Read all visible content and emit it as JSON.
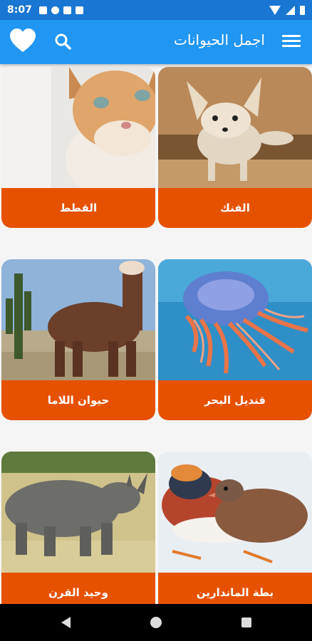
{
  "status_bar": {
    "time": "8:07"
  },
  "app_bar": {
    "title": "اجمل الحيوانات",
    "icons": [
      "heart-icon",
      "search-icon",
      "menu-icon"
    ],
    "color": "#2196f3"
  },
  "animals": [
    {
      "name": "الفنك",
      "image": "fennec-fox"
    },
    {
      "name": "القطط",
      "image": "cat"
    },
    {
      "name": "قنديل البحر",
      "image": "jellyfish"
    },
    {
      "name": "حيوان اللاما",
      "image": "llama"
    },
    {
      "name": "بطة الماندارين",
      "image": "mandarin-duck"
    },
    {
      "name": "وحيد القرن",
      "image": "rhinoceros"
    }
  ],
  "accent_color": "#e65100"
}
